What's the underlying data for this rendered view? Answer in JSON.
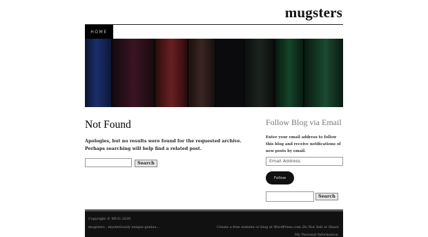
{
  "site": {
    "title": "mugsters"
  },
  "nav": {
    "home": "HOME"
  },
  "main": {
    "heading": "Not Found",
    "message": "Apologies, but no results were found for the requested archive. Perhaps searching will help find a related post.",
    "search_button": "Search"
  },
  "sidebar": {
    "follow_title": "Follow Blog via Email",
    "follow_text": "Enter your email address to follow this blog and receive notifications of new posts by email.",
    "email_placeholder": "Email Address",
    "follow_button": "Follow",
    "search_button": "Search"
  },
  "footer": {
    "copyright": "Copyright © MUG 2020",
    "tagline": "mugsters : mysteriously unique genius...",
    "wordpress_link": "Create a free website or blog at WordPress.com.",
    "dns_link_1": "Do Not Sell or Share",
    "dns_link_2": "My Personal Information"
  },
  "colors": {
    "nav_active_bg": "#000000",
    "footer_bg": "#111111",
    "follow_button_bg": "#111111"
  }
}
